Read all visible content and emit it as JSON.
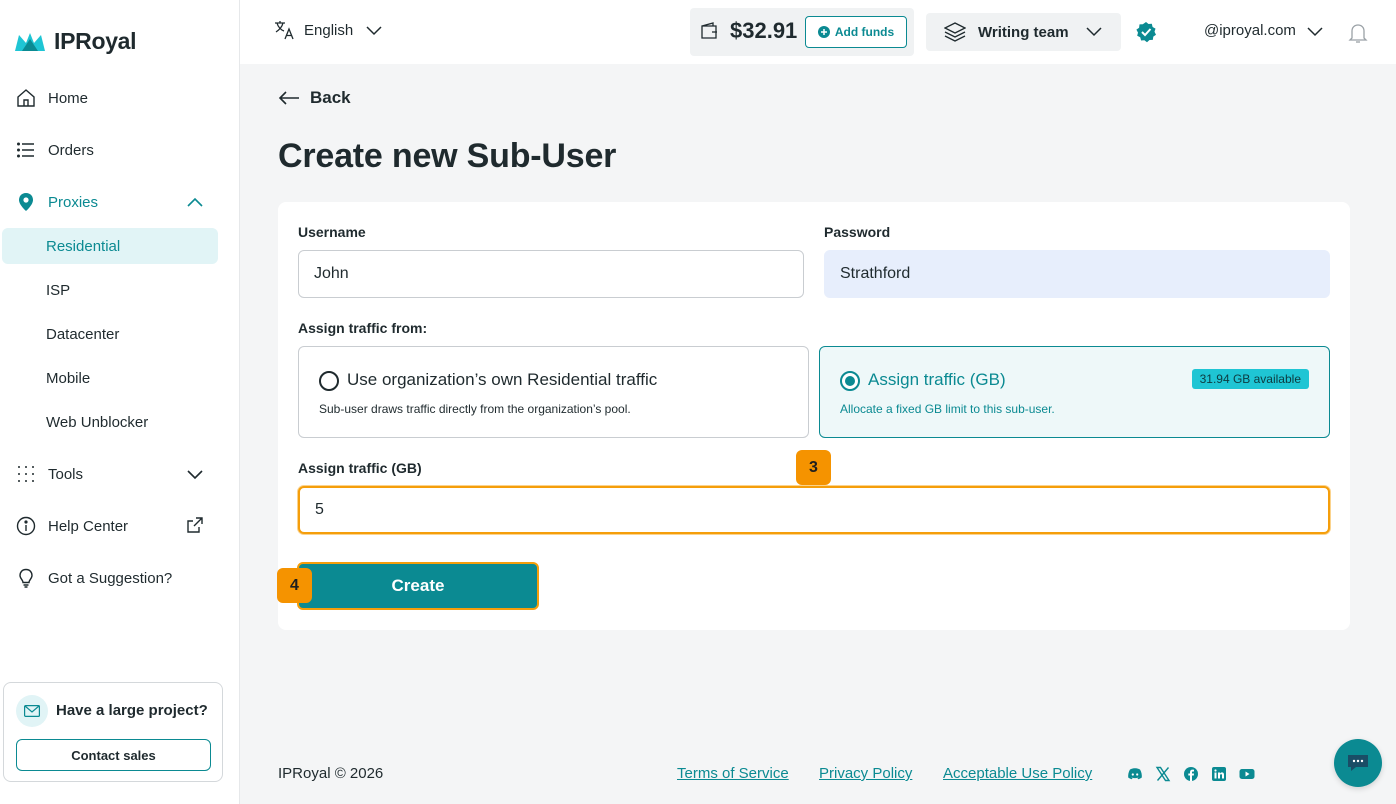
{
  "brand": {
    "name": "IPRoyal",
    "accent": "#0b8a92",
    "marker_color": "#f59300"
  },
  "sidebar": {
    "items": [
      {
        "label": "Home",
        "icon": "home-icon"
      },
      {
        "label": "Orders",
        "icon": "list-icon"
      },
      {
        "label": "Proxies",
        "icon": "location-pin-icon",
        "expanded": true
      },
      {
        "label": "Tools",
        "icon": "grid-dots-icon",
        "expanded": false
      },
      {
        "label": "Help Center",
        "icon": "info-icon",
        "external": true
      },
      {
        "label": "Got a Suggestion?",
        "icon": "lightbulb-icon"
      }
    ],
    "proxy_subitems": [
      "Residential",
      "ISP",
      "Datacenter",
      "Mobile",
      "Web Unblocker"
    ],
    "active_subitem": "Residential",
    "promo": {
      "title": "Have a large project?",
      "button": "Contact sales"
    }
  },
  "topbar": {
    "language": "English",
    "balance": "$32.91",
    "add_funds": "Add funds",
    "team": "Writing team",
    "account": "@iproyal.com"
  },
  "page": {
    "back_label": "Back",
    "title": "Create new Sub-User",
    "form": {
      "username_label": "Username",
      "username_value": "John",
      "password_label": "Password",
      "password_value": "Strathford",
      "assign_from_label": "Assign traffic from:",
      "option_own": {
        "title": "Use organization’s own Residential traffic",
        "description": "Sub-user draws traffic directly from the organization’s pool.",
        "selected": false
      },
      "option_assign": {
        "title": "Assign traffic (GB)",
        "description": "Allocate a fixed GB limit to this sub-user.",
        "badge": "31.94 GB available",
        "selected": true
      },
      "traffic_label": "Assign traffic (GB)",
      "traffic_value": "5",
      "create_button": "Create"
    },
    "markers": [
      "3",
      "4"
    ]
  },
  "footer": {
    "copyright": "IPRoyal © 2026",
    "links": [
      "Terms of Service",
      "Privacy Policy",
      "Acceptable Use Policy"
    ],
    "social": [
      "discord-icon",
      "x-icon",
      "facebook-icon",
      "linkedin-icon",
      "youtube-icon"
    ]
  }
}
